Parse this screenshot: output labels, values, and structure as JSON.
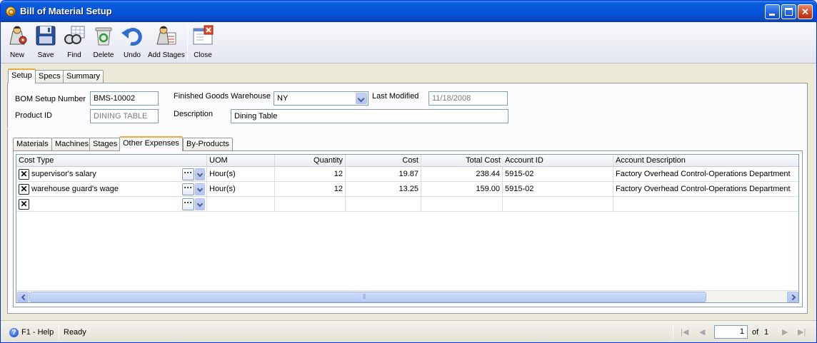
{
  "window": {
    "title": "Bill of Material Setup"
  },
  "toolbar": {
    "new_label": "New",
    "save_label": "Save",
    "find_label": "Find",
    "delete_label": "Delete",
    "undo_label": "Undo",
    "add_stages_label": "Add Stages",
    "close_label": "Close"
  },
  "tabs": [
    "Setup",
    "Specs",
    "Summary"
  ],
  "form": {
    "bom_setup_number_label": "BOM Setup Number",
    "bom_setup_number": "BMS-10002",
    "finished_goods_warehouse_label": "Finished Goods Warehouse",
    "finished_goods_warehouse": "NY",
    "last_modified_label": "Last Modified",
    "last_modified": "11/18/2008",
    "product_id_label": "Product ID",
    "product_id": "DINING TABLE",
    "description_label": "Description",
    "description": "Dining Table"
  },
  "inner_tabs": [
    "Materials",
    "Machines",
    "Stages",
    "Other Expenses",
    "By-Products"
  ],
  "grid": {
    "columns": [
      "Cost Type",
      "UOM",
      "Quantity",
      "Cost",
      "Total Cost",
      "Account ID",
      "Account Description"
    ],
    "rows": [
      {
        "cost_type": "supervisor's salary",
        "uom": "Hour(s)",
        "quantity": "12",
        "cost": "19.87",
        "total_cost": "238.44",
        "account_id": "5915-02",
        "account_description": "Factory Overhead Control-Operations Department"
      },
      {
        "cost_type": "warehouse guard's wage",
        "uom": "Hour(s)",
        "quantity": "12",
        "cost": "13.25",
        "total_cost": "159.00",
        "account_id": "5915-02",
        "account_description": "Factory Overhead Control-Operations Department"
      }
    ],
    "remove_glyph": "✕",
    "ellipsis_glyph": "···"
  },
  "status": {
    "help_label": "F1 - Help",
    "ready_label": "Ready",
    "page_current": "1",
    "page_of_label": "of",
    "page_total": "1"
  },
  "colors": {
    "title_bar": "#0855dd",
    "active_tab_accent": "#f0a93d",
    "field_border": "#7f9db9"
  }
}
